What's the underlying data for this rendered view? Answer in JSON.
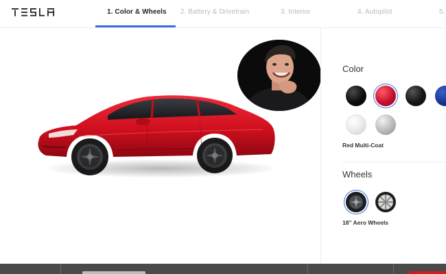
{
  "brand": {
    "logo_text": "TESLA"
  },
  "steps": [
    {
      "label": "1. Color & Wheels",
      "active": true
    },
    {
      "label": "2. Battery & Drivetrain",
      "active": false
    },
    {
      "label": "3. Interior",
      "active": false
    },
    {
      "label": "4. Autopilot",
      "active": false
    },
    {
      "label": "5.",
      "active": false
    }
  ],
  "color_section": {
    "title": "Color",
    "options": [
      {
        "name": "black",
        "color": "#0b0b0b"
      },
      {
        "name": "red",
        "color": "#c8102e",
        "selected": true
      },
      {
        "name": "midnight-silver",
        "color": "#141414"
      },
      {
        "name": "blue",
        "color": "#13308a"
      },
      {
        "name": "pearl-white",
        "color": "#f2f2f2"
      },
      {
        "name": "silver",
        "color": "#b9b9b9"
      }
    ],
    "selected_label": "Red Multi-Coat"
  },
  "wheels_section": {
    "title": "Wheels",
    "options": [
      {
        "name": "aero",
        "selected": true
      },
      {
        "name": "sport",
        "selected": false
      }
    ],
    "selected_label": "18'' Aero Wheels"
  },
  "colors": {
    "accent": "#3e6ae1",
    "car_red": "#d0111f",
    "bottom_bar": "#4a4a4a"
  }
}
